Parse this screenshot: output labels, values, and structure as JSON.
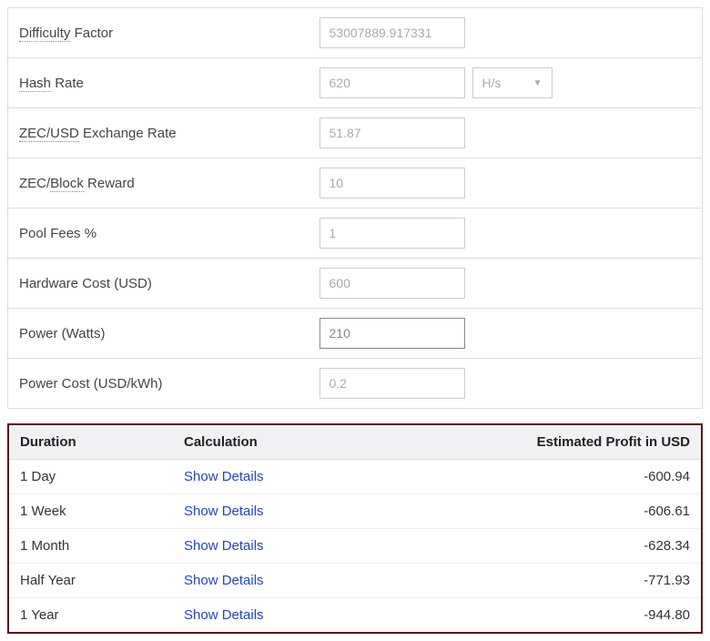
{
  "form": {
    "rows": [
      {
        "label_parts": [
          {
            "text": "Difficulty",
            "dotted": true
          },
          {
            "text": " Factor"
          }
        ],
        "value": "53007889.917331",
        "has_select": false,
        "active": false
      },
      {
        "label_parts": [
          {
            "text": "Hash",
            "dotted": true
          },
          {
            "text": " Rate"
          }
        ],
        "value": "620",
        "has_select": true,
        "select_value": "H/s",
        "active": false
      },
      {
        "label_parts": [
          {
            "text": "ZEC/USD",
            "dotted": true
          },
          {
            "text": " Exchange Rate"
          }
        ],
        "value": "51.87",
        "has_select": false,
        "active": false
      },
      {
        "label_parts": [
          {
            "text": "ZEC/"
          },
          {
            "text": "Block",
            "dotted": true
          },
          {
            "text": " Reward"
          }
        ],
        "value": "10",
        "has_select": false,
        "active": false
      },
      {
        "label_parts": [
          {
            "text": "Pool Fees %"
          }
        ],
        "value": "1",
        "has_select": false,
        "active": false
      },
      {
        "label_parts": [
          {
            "text": "Hardware Cost (USD)"
          }
        ],
        "value": "600",
        "has_select": false,
        "active": false
      },
      {
        "label_parts": [
          {
            "text": "Power (Watts)"
          }
        ],
        "value": "210",
        "has_select": false,
        "active": true
      },
      {
        "label_parts": [
          {
            "text": "Power Cost (USD/kWh)"
          }
        ],
        "value": "0.2",
        "has_select": false,
        "active": false
      }
    ]
  },
  "results": {
    "headers": {
      "duration": "Duration",
      "calculation": "Calculation",
      "profit": "Estimated Profit in USD"
    },
    "link_text": "Show Details",
    "rows": [
      {
        "duration": "1 Day",
        "profit": "-600.94"
      },
      {
        "duration": "1 Week",
        "profit": "-606.61"
      },
      {
        "duration": "1 Month",
        "profit": "-628.34"
      },
      {
        "duration": "Half Year",
        "profit": "-771.93"
      },
      {
        "duration": "1 Year",
        "profit": "-944.80"
      }
    ]
  }
}
